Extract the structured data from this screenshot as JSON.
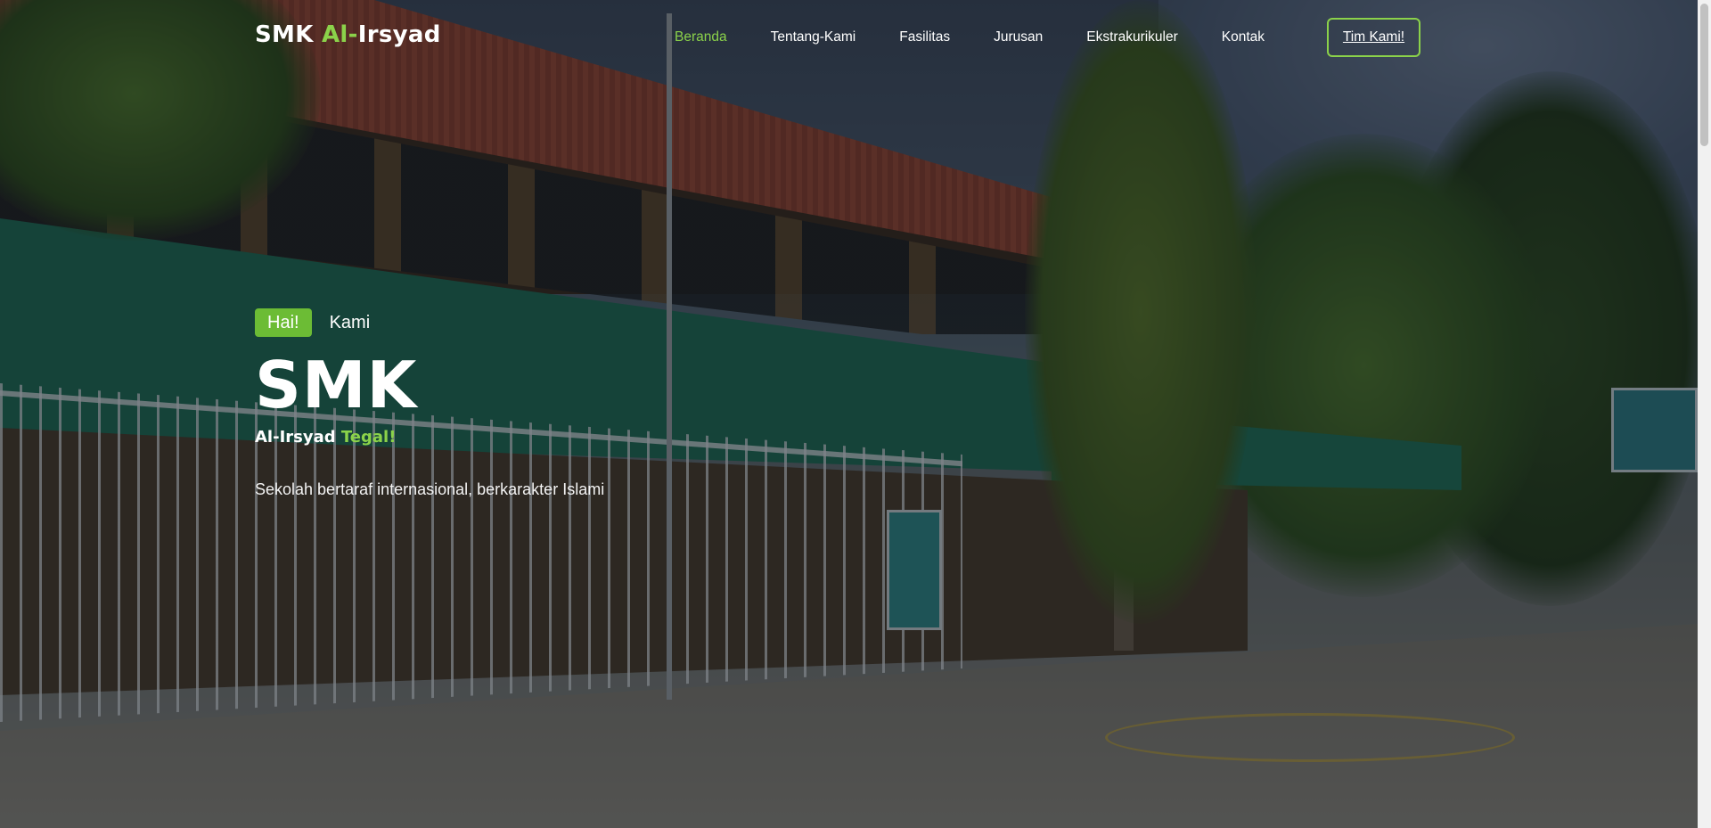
{
  "brand": {
    "part1": "SMK ",
    "part2": "Al-",
    "part3": "Irsyad"
  },
  "nav": {
    "items": [
      {
        "label": "Beranda",
        "active": true
      },
      {
        "label": "Tentang-Kami",
        "active": false
      },
      {
        "label": "Fasilitas",
        "active": false
      },
      {
        "label": "Jurusan",
        "active": false
      },
      {
        "label": "Ekstrakurikuler",
        "active": false
      },
      {
        "label": "Kontak",
        "active": false
      }
    ],
    "cta_label": "Tim Kami!"
  },
  "hero": {
    "badge": "Hai!",
    "greet_text": "Kami",
    "title": "SMK",
    "subtitle_main": "Al-Irsyad ",
    "subtitle_accent": "Tegal!",
    "tagline": "Sekolah bertaraf internasional, berkarakter Islami"
  },
  "colors": {
    "accent": "#8bd24a",
    "badge_bg": "#6cbc35",
    "text": "#ffffff"
  }
}
